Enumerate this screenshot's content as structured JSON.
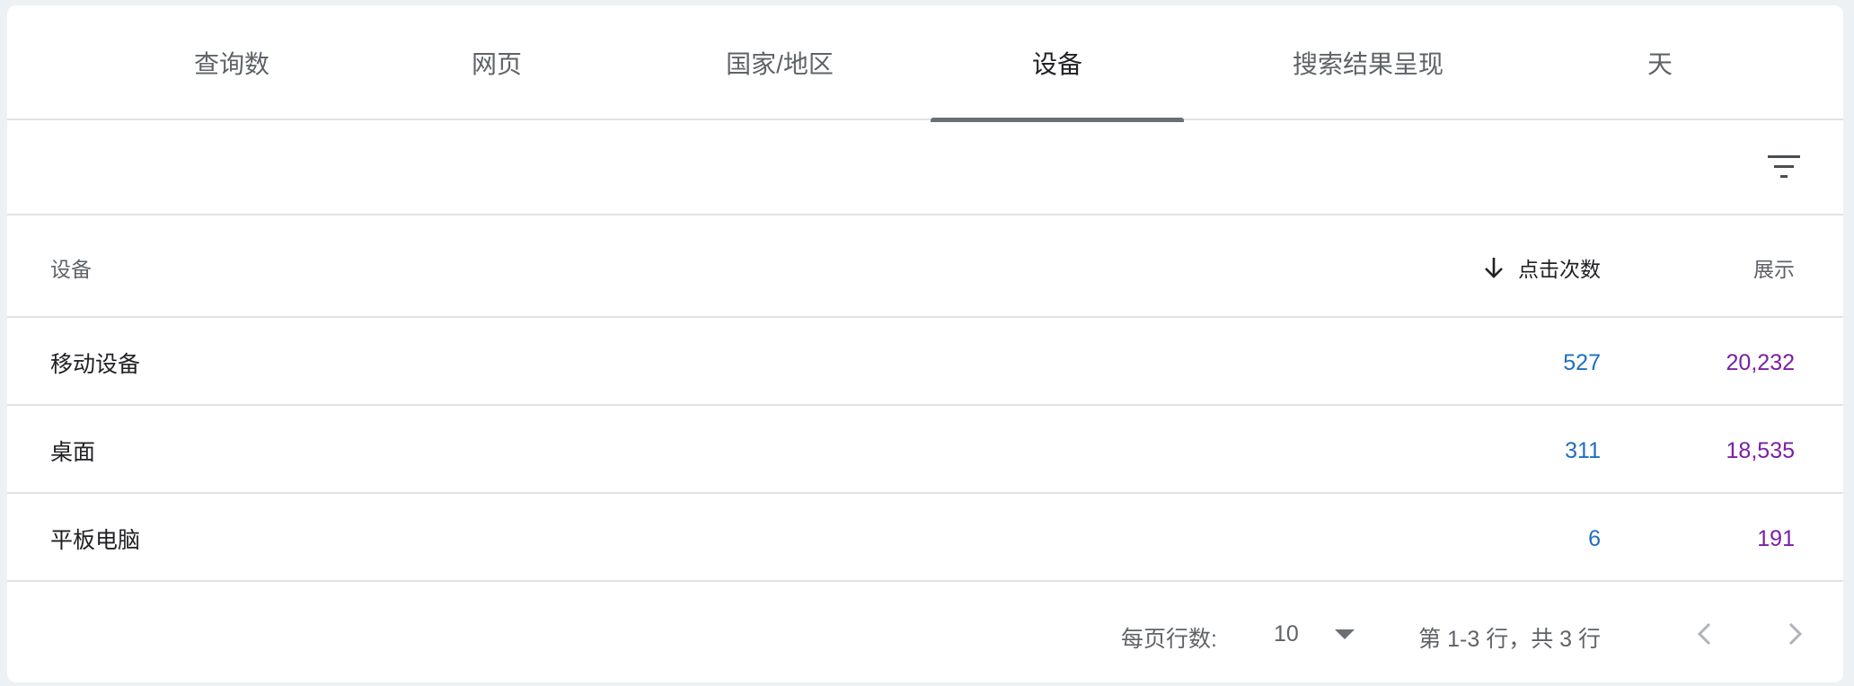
{
  "tabs": [
    {
      "label": "查询数",
      "active": false
    },
    {
      "label": "网页",
      "active": false
    },
    {
      "label": "国家/地区",
      "active": false
    },
    {
      "label": "设备",
      "active": true
    },
    {
      "label": "搜索结果呈现",
      "active": false
    },
    {
      "label": "天",
      "active": false
    }
  ],
  "filter": {
    "icon": "filter-list-icon"
  },
  "table": {
    "headers": {
      "device": "设备",
      "clicks": "点击次数",
      "impressions": "展示"
    },
    "sort_icon": "arrow-down-icon",
    "rows": [
      {
        "device": "移动设备",
        "clicks": "527",
        "impressions": "20,232"
      },
      {
        "device": "桌面",
        "clicks": "311",
        "impressions": "18,535"
      },
      {
        "device": "平板电脑",
        "clicks": "6",
        "impressions": "191"
      }
    ]
  },
  "footer": {
    "rows_per_page_label": "每页行数:",
    "rows_per_page_value": "10",
    "range_text": "第 1-3 行，共 3 行",
    "prev_icon": "chevron-left-icon",
    "next_icon": "chevron-right-icon"
  },
  "colors": {
    "clicks": "#1e6fbf",
    "impressions": "#7b1fa2",
    "tab_indicator": "#6b6f73"
  }
}
